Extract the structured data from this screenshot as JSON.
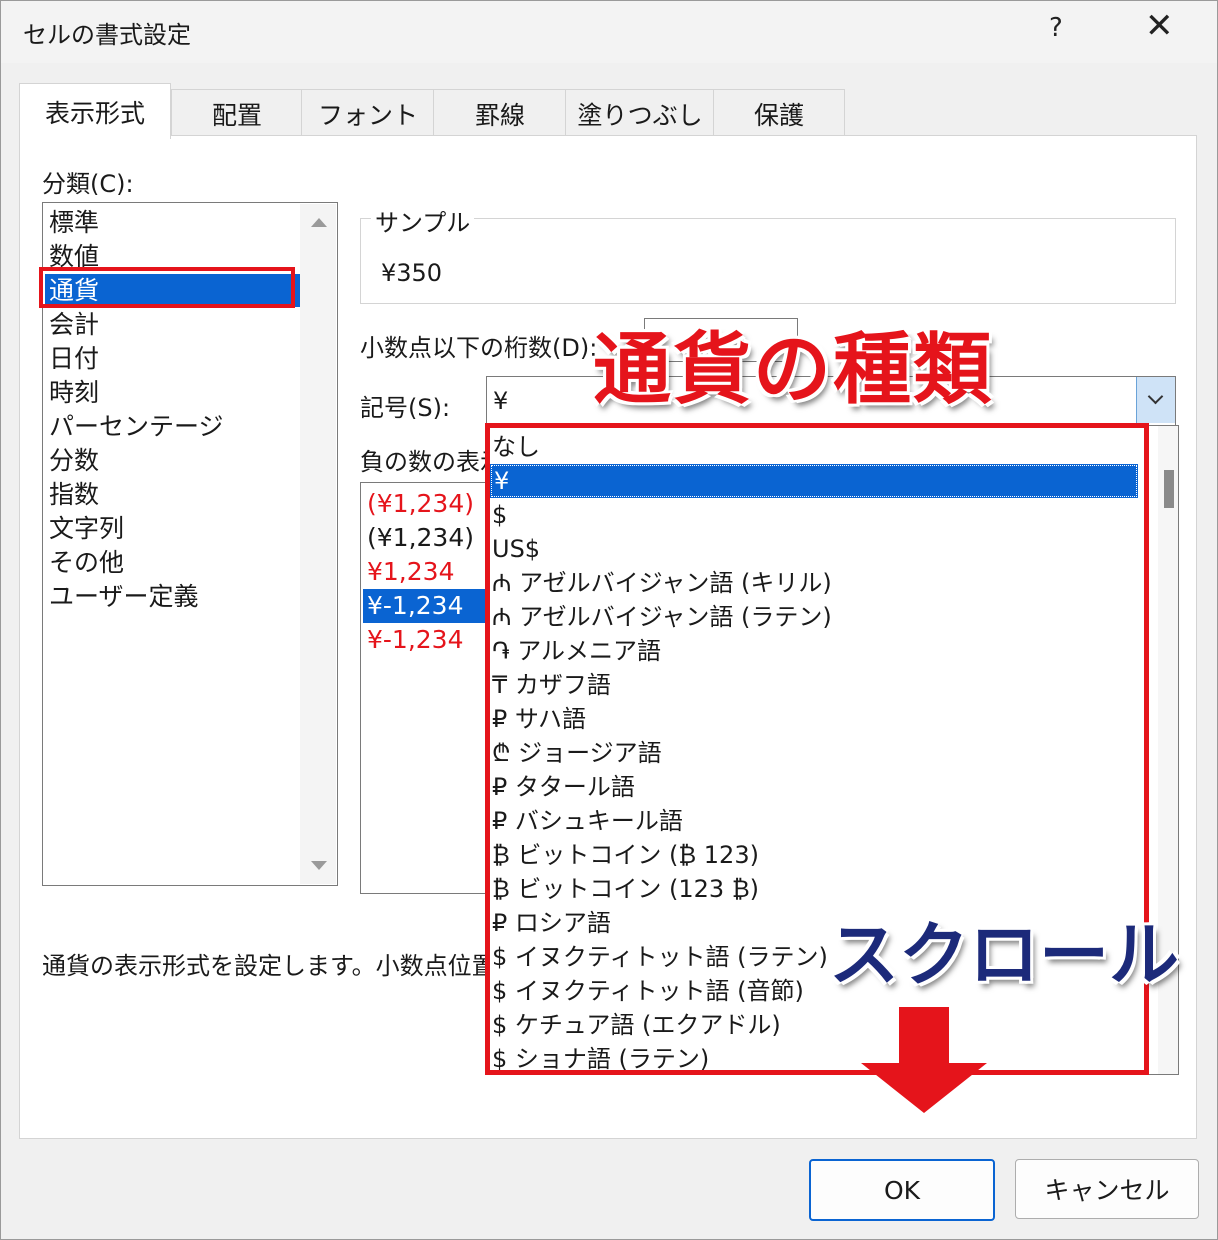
{
  "window": {
    "title": "セルの書式設定",
    "help": "?",
    "close": "✕"
  },
  "tabs": [
    "表示形式",
    "配置",
    "フォント",
    "罫線",
    "塗りつぶし",
    "保護"
  ],
  "category": {
    "label": "分類(C):",
    "items": [
      "標準",
      "数値",
      "通貨",
      "会計",
      "日付",
      "時刻",
      "パーセンテージ",
      "分数",
      "指数",
      "文字列",
      "その他",
      "ユーザー定義"
    ],
    "selected": "通貨"
  },
  "sample": {
    "legend": "サンプル",
    "value": "¥350"
  },
  "decimal": {
    "label": "小数点以下の桁数(D):"
  },
  "symbol": {
    "label": "記号(S):",
    "value": "¥"
  },
  "negative": {
    "label": "負の数の表示形式(N):",
    "items": [
      "(¥1,234)",
      "(¥1,234)",
      "¥1,234",
      "¥-1,234",
      "¥-1,234"
    ]
  },
  "description": "通貨の表示形式を設定します。小数点位置をそろえるには会計を使用します。",
  "dropdown": {
    "items": [
      "なし",
      "¥",
      "$",
      "US$",
      "₼ アゼルバイジャン語 (キリル)",
      "₼ アゼルバイジャン語 (ラテン)",
      "֏ アルメニア語",
      "₸ カザフ語",
      "₽ サハ語",
      "₾ ジョージア語",
      "₽ タタール語",
      "₽ バシュキール語",
      "₿ ビットコイン (₿ 123)",
      "₿ ビットコイン (123 ₿)",
      "₽ ロシア語",
      "$ イヌクティトット語 (ラテン)",
      "$ イヌクティトット語 (音節)",
      "$ ケチュア語 (エクアドル)",
      "$ ショナ語 (ラテン)"
    ],
    "selected": "¥"
  },
  "annotations": {
    "types": "通貨の種類",
    "scroll": "スクロール"
  },
  "buttons": {
    "ok": "OK",
    "cancel": "キャンセル"
  },
  "colors": {
    "accent": "#0a64d2",
    "annotation_red": "#e5141b",
    "annotation_navy": "#1c2a7a"
  }
}
